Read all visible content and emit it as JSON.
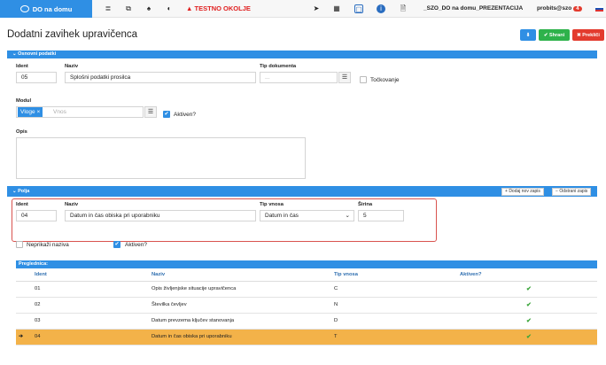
{
  "topbar": {
    "brand": "DO na domu",
    "warning": "TESTNO OKOLJE",
    "presentation": "_SZO_DO na domu_PREZENTACIJA",
    "user": "probits@szo",
    "badge_count": "4",
    "icons": [
      "list-icon",
      "external-icon",
      "bell-icon",
      "contrast-icon",
      "send-icon",
      "keyboard-icon",
      "panel-icon",
      "info-icon",
      "document-icon"
    ]
  },
  "page": {
    "title": "Dodatni zavihek upravičenca",
    "save_label": "Shrani",
    "cancel_label": "Prekliči"
  },
  "basic": {
    "section_label": "Osnovni podatki",
    "ident_label": "Ident",
    "ident_value": "05",
    "name_label": "Naziv",
    "name_value": "Splošni podatki prosilca",
    "type_label": "Tip dokumenta",
    "type_placeholder": "...",
    "scoring_label": "Točkovanje",
    "module_label": "Modul",
    "module_tag": "Vloge",
    "module_placeholder": "Vnos",
    "active_label": "Aktiven?",
    "desc_label": "Opis"
  },
  "fields": {
    "section_label": "Polja",
    "add_label": "Dodaj nov zapis",
    "remove_label": "Odstrani zapis",
    "ident_label": "Ident",
    "ident_value": "04",
    "name_label": "Naziv",
    "name_value": "Datum in čas obiska pri uporabniku",
    "type_label": "Tip vnosa",
    "type_value": "Datum in čas",
    "width_label": "Širina",
    "width_value": "5",
    "hide_label": "Neprikaži naziva",
    "active_label": "Aktiven?"
  },
  "grid": {
    "title": "Preglednica:",
    "columns": [
      "Ident",
      "Naziv",
      "Tip vnosa",
      "Aktiven?"
    ],
    "rows": [
      {
        "ident": "01",
        "name": "Opis življenjske situacije upravičenca",
        "type": "C",
        "active": "✔"
      },
      {
        "ident": "02",
        "name": "Številka čevljev",
        "type": "N",
        "active": "✔"
      },
      {
        "ident": "03",
        "name": "Datum prevzema ključev stanovanja",
        "type": "D",
        "active": "✔"
      },
      {
        "ident": "04",
        "name": "Datum in čas obiska pri uporabniku",
        "type": "T",
        "active": "✔"
      }
    ],
    "selected_index": 3
  },
  "colors": {
    "accent": "#2f8fe4",
    "save": "#2eb24b",
    "cancel": "#e33b2e",
    "selected_row": "#f3b249"
  }
}
